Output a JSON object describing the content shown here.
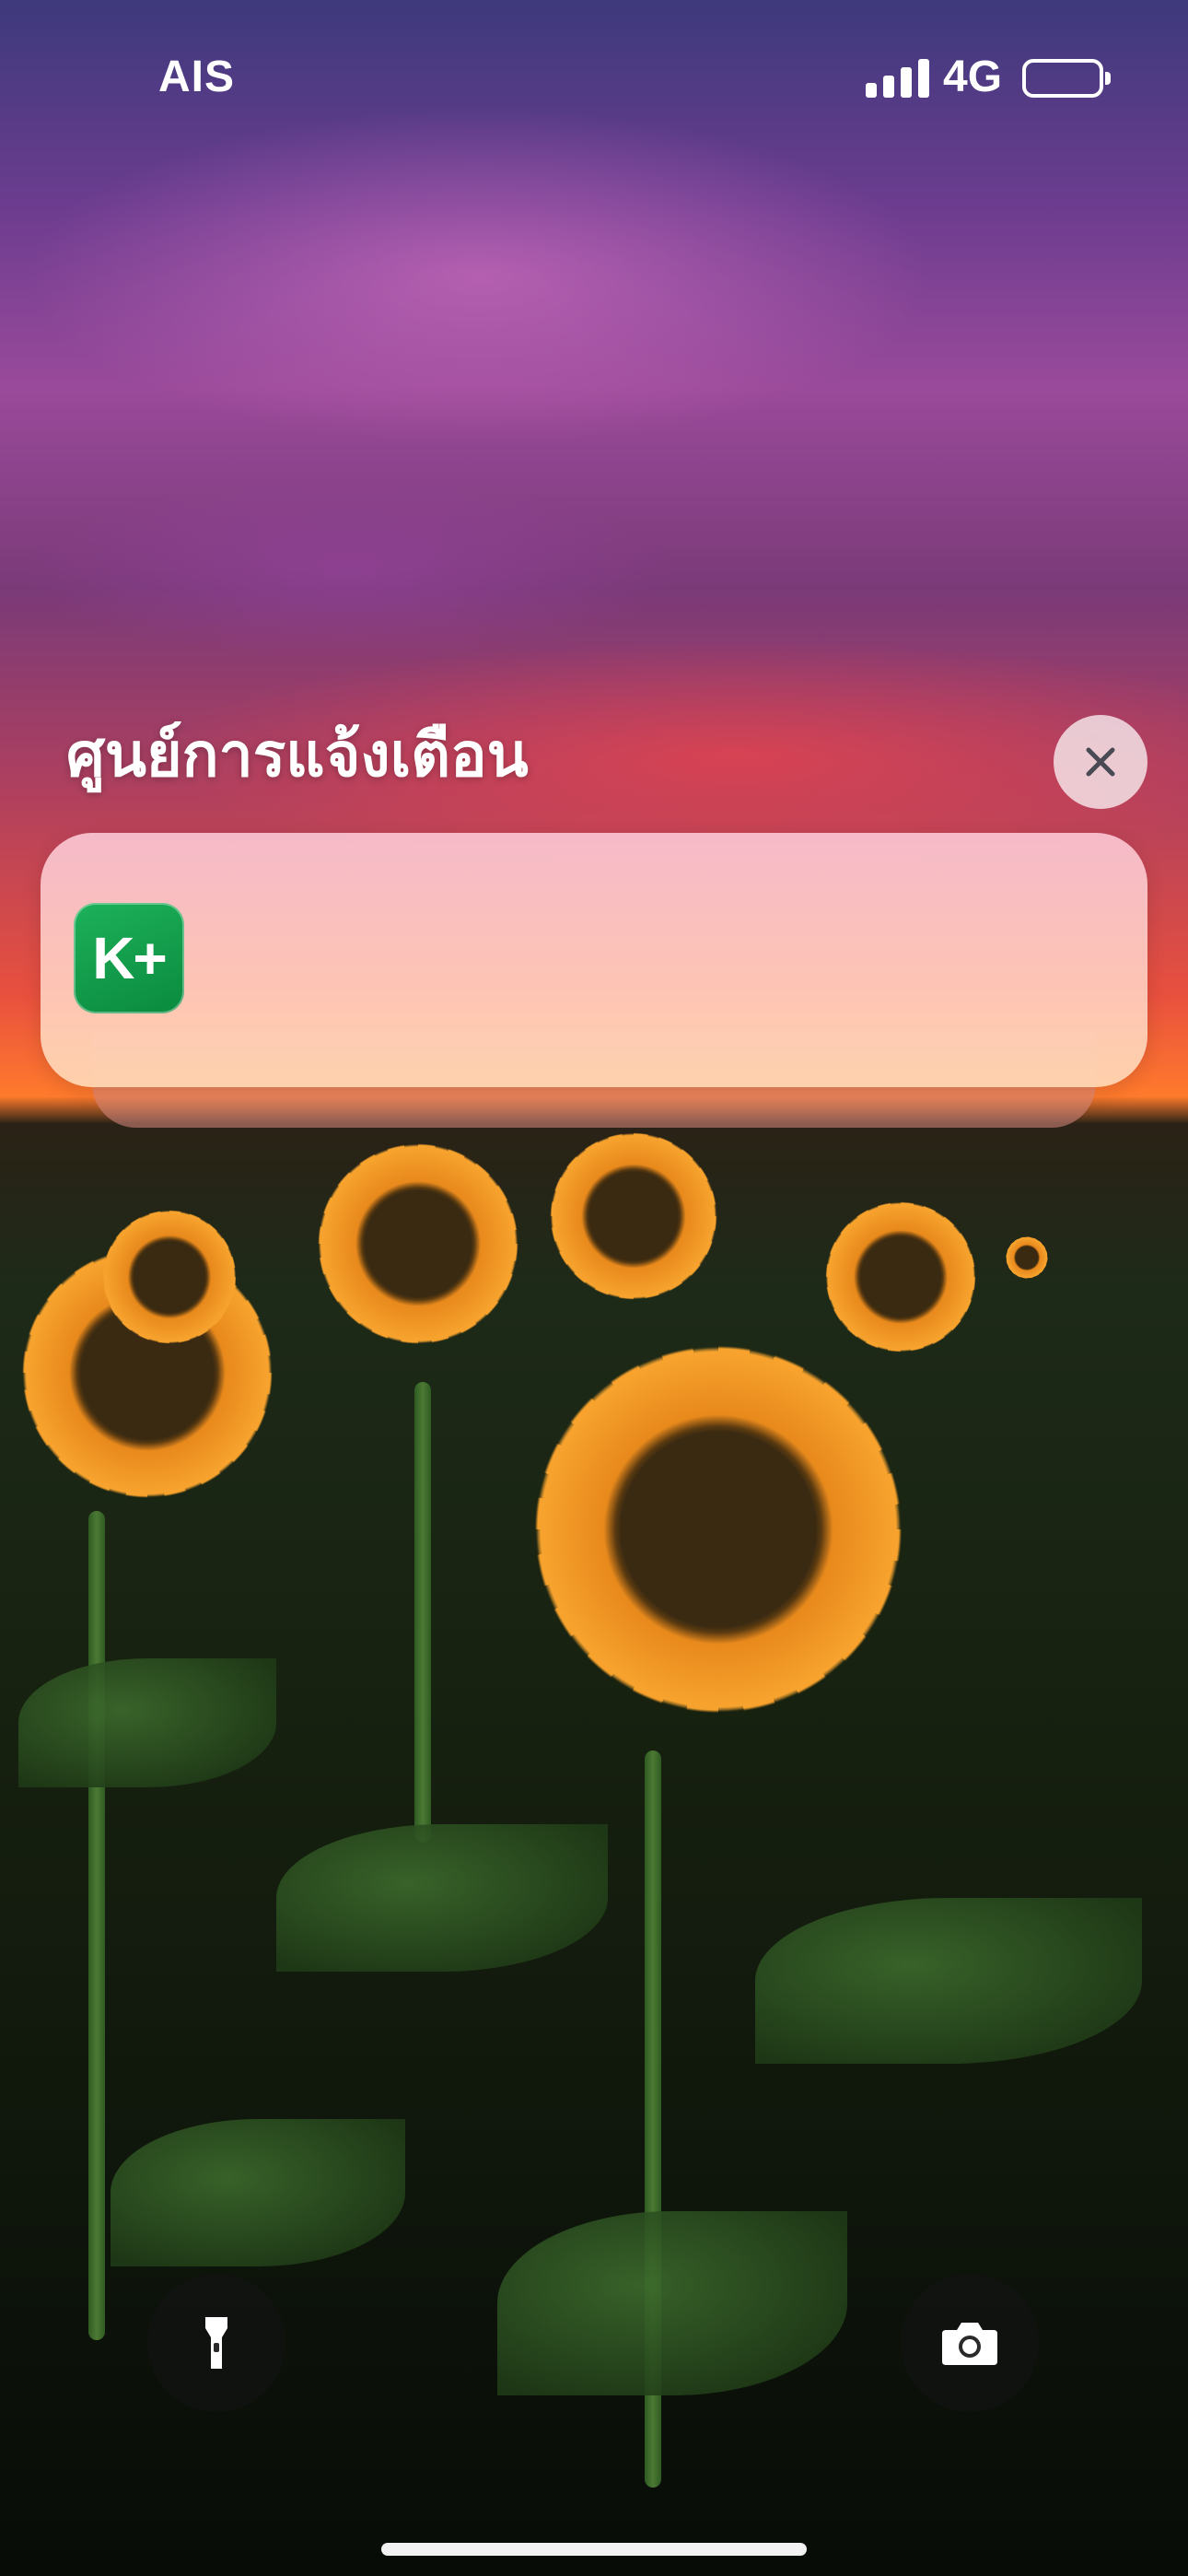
{
  "status_bar": {
    "carrier": "AIS",
    "network": "4G",
    "signal_bars": 4,
    "battery_icon": "battery-icon"
  },
  "notification_center": {
    "title": "ศูนย์การแจ้งเตือน",
    "close_icon": "close-icon"
  },
  "notification": {
    "app_icon_text": "K+",
    "app_icon_color": "#0a8a3e"
  },
  "quick_actions": {
    "left_icon": "flashlight-icon",
    "right_icon": "camera-icon"
  }
}
